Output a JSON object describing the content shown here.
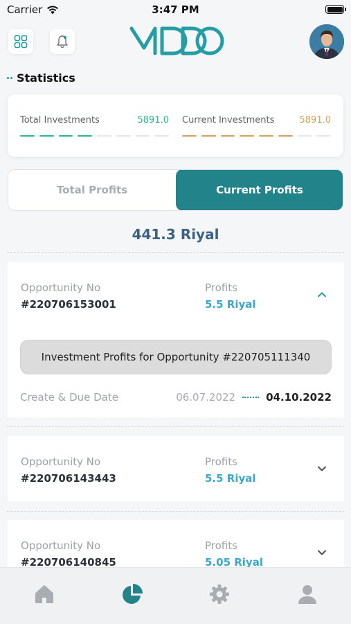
{
  "status_bar": {
    "carrier": "Carrier",
    "time": "3:47 PM"
  },
  "header": {
    "logo_text": "MDDO"
  },
  "section_title": "Statistics",
  "stats": {
    "total": {
      "label": "Total Investments",
      "value": "5891.0",
      "color": "#2bb58a",
      "filled_fraction": 0.5
    },
    "current": {
      "label": "Current Investments",
      "value": "5891.0",
      "color": "#d3a15b",
      "filled_fraction": 0.75
    }
  },
  "tabs": [
    {
      "label": "Total Profits",
      "active": false
    },
    {
      "label": "Current Profits",
      "active": true
    }
  ],
  "current_total": "441.3 Riyal",
  "opportunities": [
    {
      "label": "Opportunity No",
      "number": "#220706153001",
      "profits_label": "Profits",
      "profits": "5.5 Riyal",
      "expanded": true,
      "detail_title": "Investment Profits for Opportunity #220705111340",
      "date_label": "Create & Due Date",
      "date_start": "06.07.2022",
      "date_end": "04.10.2022"
    },
    {
      "label": "Opportunity No",
      "number": "#220706143443",
      "profits_label": "Profits",
      "profits": "5.5 Riyal",
      "expanded": false
    },
    {
      "label": "Opportunity No",
      "number": "#220706140845",
      "profits_label": "Profits",
      "profits": "5.05 Riyal",
      "expanded": false
    }
  ],
  "nav": {
    "items": [
      {
        "icon": "home-icon",
        "active": false
      },
      {
        "icon": "pie-chart-icon",
        "active": true
      },
      {
        "icon": "gear-icon",
        "active": false
      },
      {
        "icon": "user-icon",
        "active": false
      }
    ],
    "active_color": "#23838a",
    "inactive_color": "#a9adb2"
  },
  "colors": {
    "accent": "#23838a",
    "profit": "#3aa8c9",
    "amount": "#3b6183"
  }
}
